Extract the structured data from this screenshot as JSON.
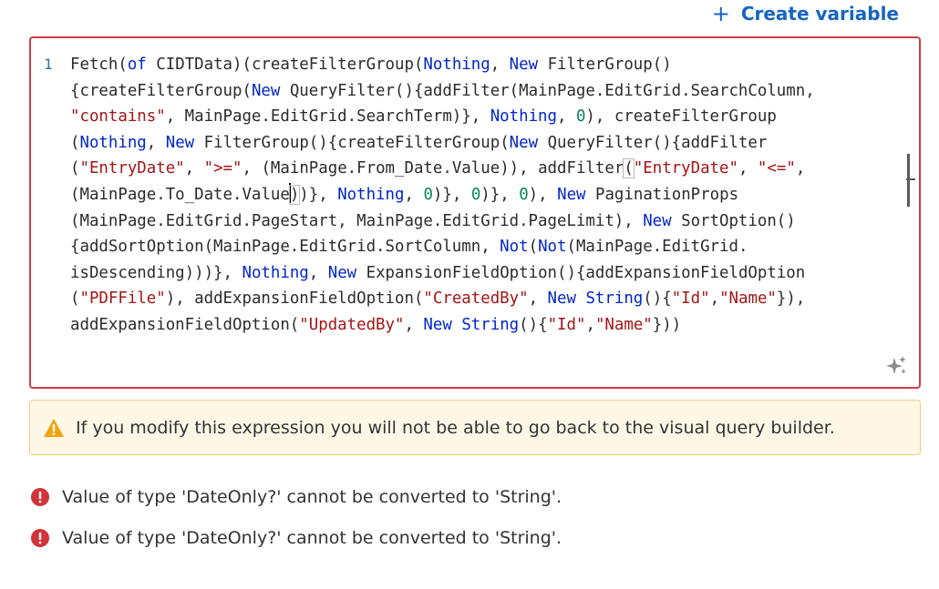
{
  "header": {
    "create_variable_icon": "plus-icon",
    "create_variable_label": "Create variable"
  },
  "editor": {
    "line_number": "1",
    "ai_icon": "sparkle-icon",
    "border_color": "#d03c43"
  },
  "code": {
    "l1": [
      "Fetch(",
      "of",
      " CIDTData)(createFilterGroup(",
      "Nothing",
      ", ",
      "New",
      " FilterGroup()"
    ],
    "l2": [
      "{createFilterGroup(",
      "New",
      " QueryFilter(){addFilter(MainPage.EditGrid.SearchColumn,"
    ],
    "l3": [
      "\"contains\"",
      ", MainPage.EditGrid.SearchTerm)}, ",
      "Nothing",
      ", ",
      "0",
      "), createFilterGroup"
    ],
    "l4": [
      "(",
      "Nothing",
      ", ",
      "New",
      " FilterGroup(){createFilterGroup(",
      "New",
      " QueryFilter(){addFilter"
    ],
    "l5": [
      "(",
      "\"EntryDate\"",
      ", ",
      "\">=\"",
      ", (MainPage.From_Date.Value)), addFilter",
      "(",
      "\"EntryDate\"",
      ", ",
      "\"<=\"",
      ","
    ],
    "l6": [
      "(MainPage.To_Date.Value",
      ")",
      ")}, ",
      "Nothing",
      ", ",
      "0",
      ")}, ",
      "0",
      ")}, ",
      "0",
      "), ",
      "New",
      " PaginationProps"
    ],
    "l7": [
      "(MainPage.EditGrid.PageStart, MainPage.EditGrid.PageLimit), ",
      "New",
      " SortOption()"
    ],
    "l8": [
      "{addSortOption(MainPage.EditGrid.SortColumn, ",
      "Not",
      "(",
      "Not",
      "(MainPage.EditGrid."
    ],
    "l9": [
      "isDescending)))}, ",
      "Nothing",
      ", ",
      "New",
      " ExpansionFieldOption(){addExpansionFieldOption"
    ],
    "l10": [
      "(",
      "\"PDFFile\"",
      "), addExpansionFieldOption(",
      "\"CreatedBy\"",
      ", ",
      "New",
      " ",
      "String",
      "(){",
      "\"Id\"",
      ",",
      "\"Name\"",
      "}),"
    ],
    "l11": [
      "addExpansionFieldOption(",
      "\"UpdatedBy\"",
      ", ",
      "New",
      " ",
      "String",
      "(){",
      "\"Id\"",
      ",",
      "\"Name\"",
      "}))"
    ]
  },
  "warning": {
    "icon": "warning-icon",
    "text": "If you modify this expression you will not be able to go back to the visual query builder."
  },
  "errors": [
    {
      "icon": "error-icon",
      "text": "Value of type 'DateOnly?' cannot be converted to 'String'."
    },
    {
      "icon": "error-icon",
      "text": "Value of type 'DateOnly?' cannot be converted to 'String'."
    }
  ],
  "colors": {
    "accent": "#1565c0",
    "keyword": "#0026c9",
    "string": "#a31515",
    "number": "#098658",
    "warning_bg": "#fff7e6",
    "warning_icon": "#f0a30a",
    "error": "#d13438"
  }
}
